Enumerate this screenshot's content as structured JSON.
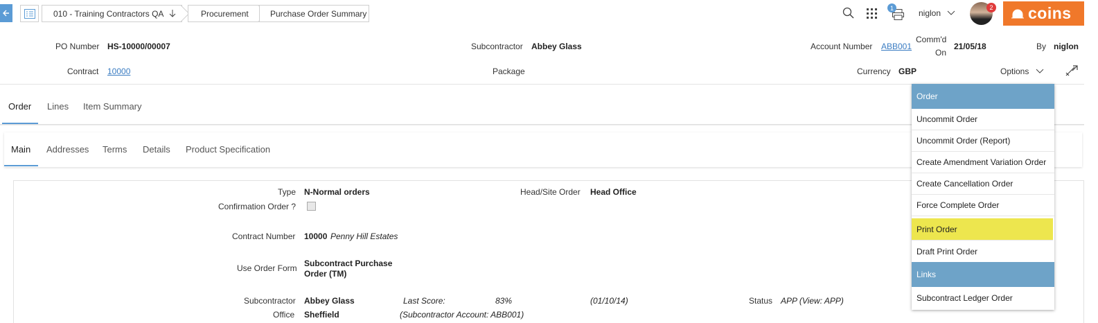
{
  "topbar": {
    "breadcrumbs": [
      "010 - Training Contractors QA",
      "Procurement",
      "Purchase Order Summary"
    ],
    "notification_count": "1",
    "user": "niglon",
    "avatar_badge": "2",
    "brand": "coins"
  },
  "header": {
    "po_number_label": "PO Number",
    "po_number": "HS-10000/00007",
    "subcontractor_label": "Subcontractor",
    "subcontractor": "Abbey Glass",
    "account_number_label": "Account Number",
    "account_number": "ABB001",
    "commd_on_label_1": "Comm'd",
    "commd_on_label_2": "On",
    "commd_on": "21/05/18",
    "by_label": "By",
    "by": "niglon",
    "contract_label": "Contract",
    "contract": "10000",
    "package_label": "Package",
    "currency_label": "Currency",
    "currency": "GBP",
    "options_label": "Options"
  },
  "main_tabs": [
    "Order",
    "Lines",
    "Item Summary"
  ],
  "sub_tabs": [
    "Main",
    "Addresses",
    "Terms",
    "Details",
    "Product Specification"
  ],
  "form": {
    "type_label": "Type",
    "type": "N-Normal orders",
    "head_site_label": "Head/Site Order",
    "head_site": "Head Office",
    "confirmation_label": "Confirmation Order ?",
    "contract_number_label": "Contract Number",
    "contract_number": "10000",
    "contract_name": "Penny Hill Estates",
    "use_order_form_label": "Use Order Form",
    "use_order_form_1": "Subcontract Purchase",
    "use_order_form_2": "Order (TM)",
    "subcontractor_label": "Subcontractor",
    "subcontractor": "Abbey Glass",
    "last_score_label": "Last Score:",
    "last_score": "83%",
    "last_score_date": "(01/10/14)",
    "status_label": "Status",
    "status": "APP (View: APP)",
    "office_label": "Office",
    "office": "Sheffield",
    "sub_account": "(Subcontractor Account: ABB001)"
  },
  "dropdown": {
    "order_header": "Order",
    "order_items": [
      "Uncommit Order",
      "Uncommit Order (Report)",
      "Create Amendment Variation Order",
      "Create Cancellation Order",
      "Force Complete Order",
      "Print Order",
      "Draft Print Order"
    ],
    "links_header": "Links",
    "links_items": [
      "Subcontract Ledger Order"
    ]
  }
}
